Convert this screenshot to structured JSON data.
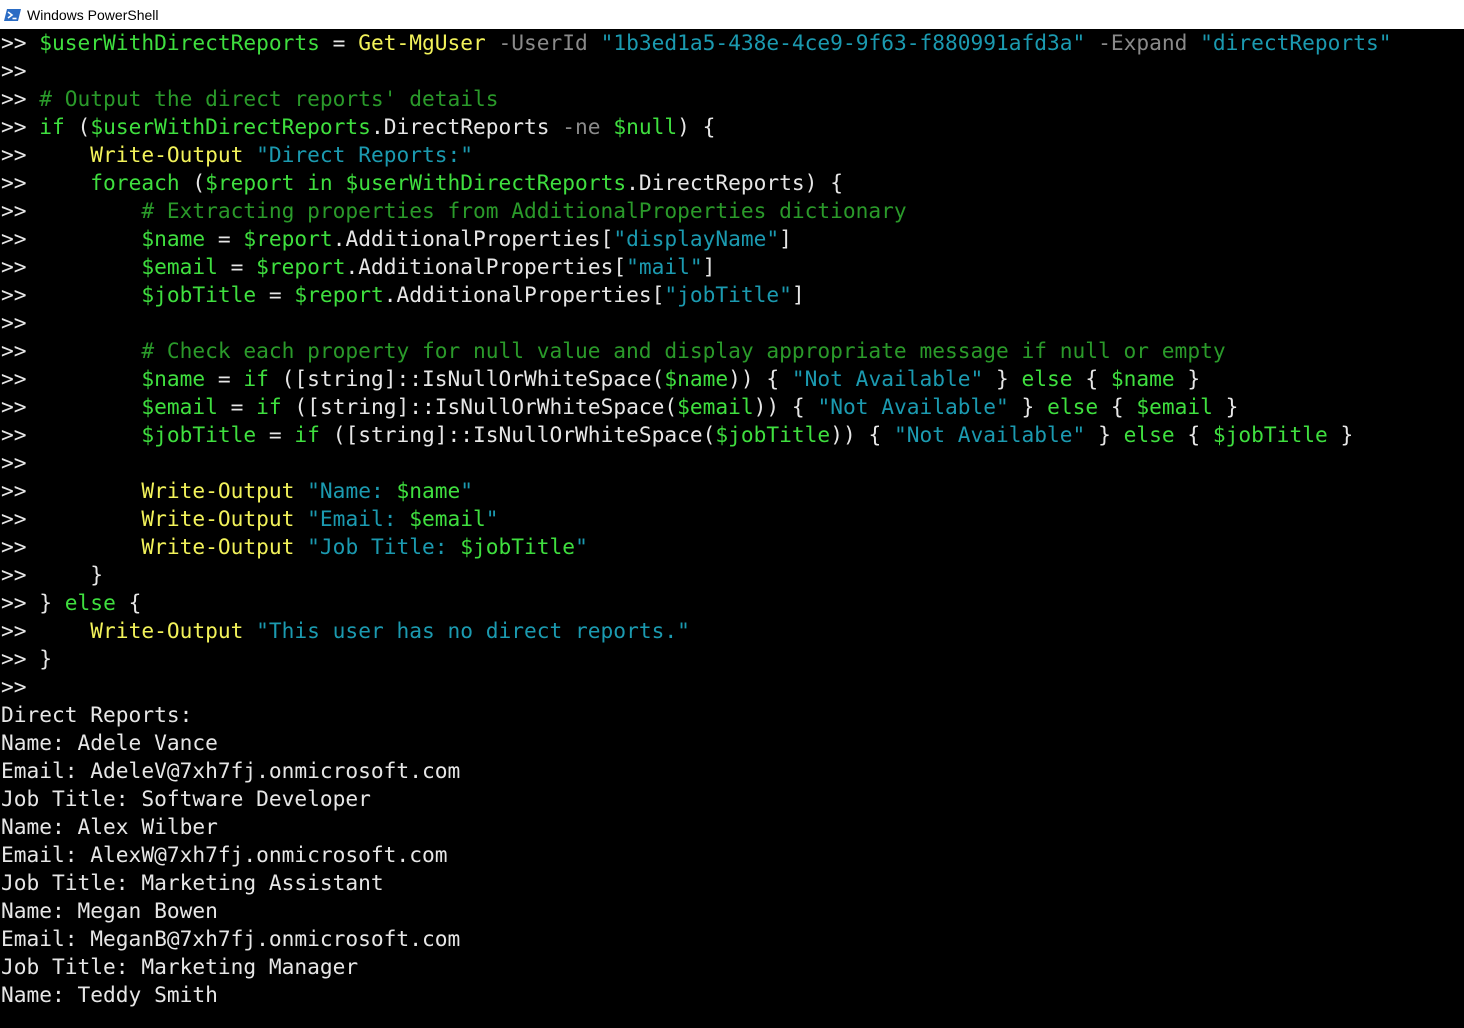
{
  "window": {
    "title": "Windows PowerShell"
  },
  "colors": {
    "background": "#000000",
    "prompt": "#e6e6e6",
    "variable": "#3fdf3f",
    "command": "#f2f25a",
    "string": "#1b9ab0",
    "parameter": "#8a8a8a",
    "keyword": "#3fdf3f",
    "comment": "#2a9a2a",
    "text": "#e6e6e6"
  },
  "console": {
    "lines": [
      {
        "t": [
          [
            "p",
            ">> "
          ],
          [
            "v",
            "$userWithDirectReports"
          ],
          [
            "o",
            " = "
          ],
          [
            "c",
            "Get-MgUser"
          ],
          [
            "x",
            " -UserId "
          ],
          [
            "s",
            "\"1b3ed1a5-438e-4ce9-9f63-f880991afd3a\""
          ],
          [
            "x",
            " -Expand "
          ],
          [
            "s",
            "\"directReports\""
          ]
        ]
      },
      {
        "t": [
          [
            "p",
            ">>"
          ]
        ]
      },
      {
        "t": [
          [
            "p",
            ">> "
          ],
          [
            "m",
            "# Output the direct reports' details"
          ]
        ]
      },
      {
        "t": [
          [
            "p",
            ">> "
          ],
          [
            "k",
            "if"
          ],
          [
            "o",
            " ("
          ],
          [
            "v",
            "$userWithDirectReports"
          ],
          [
            "o",
            ".DirectReports "
          ],
          [
            "x",
            "-ne"
          ],
          [
            "o",
            " "
          ],
          [
            "v",
            "$null"
          ],
          [
            "o",
            ") {"
          ]
        ]
      },
      {
        "t": [
          [
            "p",
            ">>     "
          ],
          [
            "c",
            "Write-Output"
          ],
          [
            "o",
            " "
          ],
          [
            "s",
            "\"Direct Reports:\""
          ]
        ]
      },
      {
        "t": [
          [
            "p",
            ">>     "
          ],
          [
            "k",
            "foreach"
          ],
          [
            "o",
            " ("
          ],
          [
            "v",
            "$report"
          ],
          [
            "o",
            " "
          ],
          [
            "k",
            "in"
          ],
          [
            "o",
            " "
          ],
          [
            "v",
            "$userWithDirectReports"
          ],
          [
            "o",
            ".DirectReports) {"
          ]
        ]
      },
      {
        "t": [
          [
            "p",
            ">>         "
          ],
          [
            "m",
            "# Extracting properties from AdditionalProperties dictionary"
          ]
        ]
      },
      {
        "t": [
          [
            "p",
            ">>         "
          ],
          [
            "v",
            "$name"
          ],
          [
            "o",
            " = "
          ],
          [
            "v",
            "$report"
          ],
          [
            "o",
            ".AdditionalProperties["
          ],
          [
            "s",
            "\"displayName\""
          ],
          [
            "o",
            "]"
          ]
        ]
      },
      {
        "t": [
          [
            "p",
            ">>         "
          ],
          [
            "v",
            "$email"
          ],
          [
            "o",
            " = "
          ],
          [
            "v",
            "$report"
          ],
          [
            "o",
            ".AdditionalProperties["
          ],
          [
            "s",
            "\"mail\""
          ],
          [
            "o",
            "]"
          ]
        ]
      },
      {
        "t": [
          [
            "p",
            ">>         "
          ],
          [
            "v",
            "$jobTitle"
          ],
          [
            "o",
            " = "
          ],
          [
            "v",
            "$report"
          ],
          [
            "o",
            ".AdditionalProperties["
          ],
          [
            "s",
            "\"jobTitle\""
          ],
          [
            "o",
            "]"
          ]
        ]
      },
      {
        "t": [
          [
            "p",
            ">>"
          ]
        ]
      },
      {
        "t": [
          [
            "p",
            ">>         "
          ],
          [
            "m",
            "# Check each property for null value and display appropriate message if null or empty"
          ]
        ]
      },
      {
        "t": [
          [
            "p",
            ">>         "
          ],
          [
            "v",
            "$name"
          ],
          [
            "o",
            " = "
          ],
          [
            "k",
            "if"
          ],
          [
            "o",
            " ([string]::IsNullOrWhiteSpace("
          ],
          [
            "v",
            "$name"
          ],
          [
            "o",
            ")) { "
          ],
          [
            "s",
            "\"Not Available\""
          ],
          [
            "o",
            " } "
          ],
          [
            "k",
            "else"
          ],
          [
            "o",
            " { "
          ],
          [
            "v",
            "$name"
          ],
          [
            "o",
            " }"
          ]
        ]
      },
      {
        "t": [
          [
            "p",
            ">>         "
          ],
          [
            "v",
            "$email"
          ],
          [
            "o",
            " = "
          ],
          [
            "k",
            "if"
          ],
          [
            "o",
            " ([string]::IsNullOrWhiteSpace("
          ],
          [
            "v",
            "$email"
          ],
          [
            "o",
            ")) { "
          ],
          [
            "s",
            "\"Not Available\""
          ],
          [
            "o",
            " } "
          ],
          [
            "k",
            "else"
          ],
          [
            "o",
            " { "
          ],
          [
            "v",
            "$email"
          ],
          [
            "o",
            " }"
          ]
        ]
      },
      {
        "t": [
          [
            "p",
            ">>         "
          ],
          [
            "v",
            "$jobTitle"
          ],
          [
            "o",
            " = "
          ],
          [
            "k",
            "if"
          ],
          [
            "o",
            " ([string]::IsNullOrWhiteSpace("
          ],
          [
            "v",
            "$jobTitle"
          ],
          [
            "o",
            ")) { "
          ],
          [
            "s",
            "\"Not Available\""
          ],
          [
            "o",
            " } "
          ],
          [
            "k",
            "else"
          ],
          [
            "o",
            " { "
          ],
          [
            "v",
            "$jobTitle"
          ],
          [
            "o",
            " }"
          ]
        ]
      },
      {
        "t": [
          [
            "p",
            ">>"
          ]
        ]
      },
      {
        "t": [
          [
            "p",
            ">>         "
          ],
          [
            "c",
            "Write-Output"
          ],
          [
            "o",
            " "
          ],
          [
            "s",
            "\"Name: "
          ],
          [
            "v",
            "$name"
          ],
          [
            "s",
            "\""
          ]
        ]
      },
      {
        "t": [
          [
            "p",
            ">>         "
          ],
          [
            "c",
            "Write-Output"
          ],
          [
            "o",
            " "
          ],
          [
            "s",
            "\"Email: "
          ],
          [
            "v",
            "$email"
          ],
          [
            "s",
            "\""
          ]
        ]
      },
      {
        "t": [
          [
            "p",
            ">>         "
          ],
          [
            "c",
            "Write-Output"
          ],
          [
            "o",
            " "
          ],
          [
            "s",
            "\"Job Title: "
          ],
          [
            "v",
            "$jobTitle"
          ],
          [
            "s",
            "\""
          ]
        ]
      },
      {
        "t": [
          [
            "p",
            ">>     "
          ],
          [
            "o",
            "}"
          ]
        ]
      },
      {
        "t": [
          [
            "p",
            ">> "
          ],
          [
            "o",
            "} "
          ],
          [
            "k",
            "else"
          ],
          [
            "o",
            " {"
          ]
        ]
      },
      {
        "t": [
          [
            "p",
            ">>     "
          ],
          [
            "c",
            "Write-Output"
          ],
          [
            "o",
            " "
          ],
          [
            "s",
            "\"This user has no direct reports.\""
          ]
        ]
      },
      {
        "t": [
          [
            "p",
            ">> "
          ],
          [
            "o",
            "}"
          ]
        ]
      },
      {
        "t": [
          [
            "p",
            ">>"
          ]
        ]
      },
      {
        "t": [
          [
            "ty",
            "Direct Reports:"
          ]
        ]
      },
      {
        "t": [
          [
            "ty",
            "Name: Adele Vance"
          ]
        ]
      },
      {
        "t": [
          [
            "ty",
            "Email: AdeleV@7xh7fj.onmicrosoft.com"
          ]
        ]
      },
      {
        "t": [
          [
            "ty",
            "Job Title: Software Developer"
          ]
        ]
      },
      {
        "t": [
          [
            "ty",
            "Name: Alex Wilber"
          ]
        ]
      },
      {
        "t": [
          [
            "ty",
            "Email: AlexW@7xh7fj.onmicrosoft.com"
          ]
        ]
      },
      {
        "t": [
          [
            "ty",
            "Job Title: Marketing Assistant"
          ]
        ]
      },
      {
        "t": [
          [
            "ty",
            "Name: Megan Bowen"
          ]
        ]
      },
      {
        "t": [
          [
            "ty",
            "Email: MeganB@7xh7fj.onmicrosoft.com"
          ]
        ]
      },
      {
        "t": [
          [
            "ty",
            "Job Title: Marketing Manager"
          ]
        ]
      },
      {
        "t": [
          [
            "ty",
            "Name: Teddy Smith"
          ]
        ]
      }
    ]
  }
}
